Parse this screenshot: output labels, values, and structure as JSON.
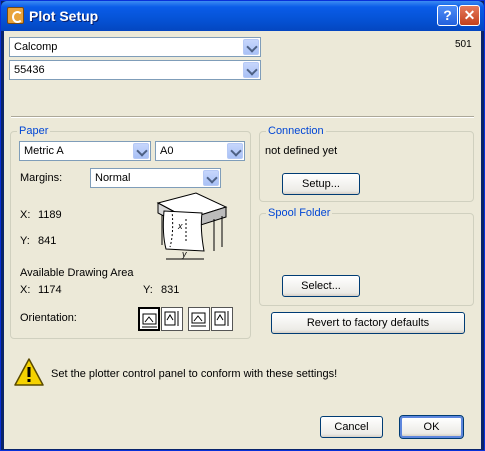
{
  "window": {
    "title": "Plot Setup"
  },
  "header": {
    "device": "Calcomp",
    "model": "55436",
    "code": "501"
  },
  "paper": {
    "group_title": "Paper",
    "size_standard": "Metric A",
    "size": "A0",
    "margins_label": "Margins:",
    "margins_value": "Normal",
    "x_label": "X:",
    "x_value": "1189",
    "y_label": "Y:",
    "y_value": "841",
    "available_label": "Available Drawing Area",
    "avail_x_label": "X:",
    "avail_x_value": "1174",
    "avail_y_label": "Y:",
    "avail_y_value": "831",
    "orientation_label": "Orientation:",
    "diagram_x": "x",
    "diagram_y": "y"
  },
  "connection": {
    "group_title": "Connection",
    "status": "not defined yet",
    "setup_label": "Setup..."
  },
  "spool": {
    "group_title": "Spool Folder",
    "select_label": "Select..."
  },
  "revert_label": "Revert to factory defaults",
  "warning_text": "Set the plotter control panel to conform with these settings!",
  "footer": {
    "cancel_label": "Cancel",
    "ok_label": "OK"
  }
}
